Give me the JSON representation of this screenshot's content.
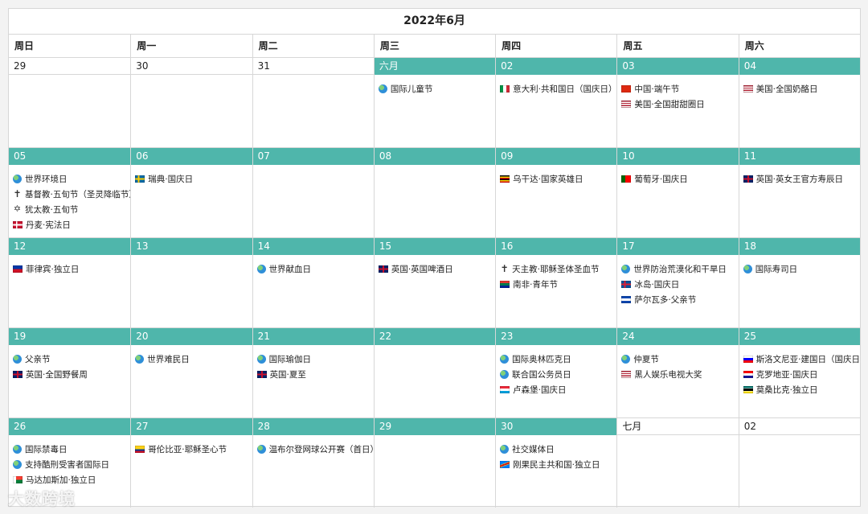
{
  "calendar": {
    "title": "2022年6月",
    "weekdays": [
      "周日",
      "周一",
      "周二",
      "周三",
      "周四",
      "周五",
      "周六"
    ],
    "weeks": [
      [
        {
          "label": "29",
          "current": false,
          "events": []
        },
        {
          "label": "30",
          "current": false,
          "events": []
        },
        {
          "label": "31",
          "current": false,
          "events": []
        },
        {
          "label": "六月",
          "current": true,
          "events": [
            {
              "icon": "globe",
              "text": "国际儿童节"
            }
          ]
        },
        {
          "label": "02",
          "current": true,
          "events": [
            {
              "icon": "flag-italy",
              "text": "意大利·共和国日（国庆日）"
            }
          ]
        },
        {
          "label": "03",
          "current": true,
          "events": [
            {
              "icon": "flag-china",
              "text": "中国·端午节"
            },
            {
              "icon": "flag-usa",
              "text": "美国·全国甜甜圈日"
            }
          ]
        },
        {
          "label": "04",
          "current": true,
          "events": [
            {
              "icon": "flag-usa",
              "text": "美国·全国奶酪日"
            }
          ]
        }
      ],
      [
        {
          "label": "05",
          "current": true,
          "events": [
            {
              "icon": "globe",
              "text": "世界环境日"
            },
            {
              "icon": "cross",
              "text": "基督教·五旬节（圣灵降临节）"
            },
            {
              "icon": "star-of-david",
              "text": "犹太教·五旬节"
            },
            {
              "icon": "flag-denmark",
              "text": "丹麦·宪法日"
            }
          ]
        },
        {
          "label": "06",
          "current": true,
          "events": [
            {
              "icon": "flag-sweden",
              "text": "瑞典·国庆日"
            }
          ]
        },
        {
          "label": "07",
          "current": true,
          "events": []
        },
        {
          "label": "08",
          "current": true,
          "events": []
        },
        {
          "label": "09",
          "current": true,
          "events": [
            {
              "icon": "flag-uganda",
              "text": "乌干达·国家英雄日"
            }
          ]
        },
        {
          "label": "10",
          "current": true,
          "events": [
            {
              "icon": "flag-portugal",
              "text": "葡萄牙·国庆日"
            }
          ]
        },
        {
          "label": "11",
          "current": true,
          "events": [
            {
              "icon": "flag-uk",
              "text": "英国·英女王官方寿辰日"
            }
          ]
        }
      ],
      [
        {
          "label": "12",
          "current": true,
          "events": [
            {
              "icon": "flag-philippines",
              "text": "菲律宾·独立日"
            }
          ]
        },
        {
          "label": "13",
          "current": true,
          "events": []
        },
        {
          "label": "14",
          "current": true,
          "events": [
            {
              "icon": "globe",
              "text": "世界献血日"
            }
          ]
        },
        {
          "label": "15",
          "current": true,
          "events": [
            {
              "icon": "flag-uk",
              "text": "英国·英国啤酒日"
            }
          ]
        },
        {
          "label": "16",
          "current": true,
          "events": [
            {
              "icon": "cross",
              "text": "天主教·耶稣圣体圣血节"
            },
            {
              "icon": "flag-south-africa",
              "text": "南非·青年节"
            }
          ]
        },
        {
          "label": "17",
          "current": true,
          "events": [
            {
              "icon": "globe",
              "text": "世界防治荒漠化和干旱日"
            },
            {
              "icon": "flag-iceland",
              "text": "冰岛·国庆日"
            },
            {
              "icon": "flag-el-salvador",
              "text": "萨尔瓦多·父亲节"
            }
          ]
        },
        {
          "label": "18",
          "current": true,
          "events": [
            {
              "icon": "globe",
              "text": "国际寿司日"
            }
          ]
        }
      ],
      [
        {
          "label": "19",
          "current": true,
          "events": [
            {
              "icon": "globe",
              "text": "父亲节"
            },
            {
              "icon": "flag-uk",
              "text": "英国·全国野餐周"
            }
          ]
        },
        {
          "label": "20",
          "current": true,
          "events": [
            {
              "icon": "globe",
              "text": "世界难民日"
            }
          ]
        },
        {
          "label": "21",
          "current": true,
          "events": [
            {
              "icon": "globe",
              "text": "国际瑜伽日"
            },
            {
              "icon": "flag-uk",
              "text": "英国·夏至"
            }
          ]
        },
        {
          "label": "22",
          "current": true,
          "events": []
        },
        {
          "label": "23",
          "current": true,
          "events": [
            {
              "icon": "globe",
              "text": "国际奥林匹克日"
            },
            {
              "icon": "globe",
              "text": "联合国公务员日"
            },
            {
              "icon": "flag-luxembourg",
              "text": "卢森堡·国庆日"
            }
          ]
        },
        {
          "label": "24",
          "current": true,
          "events": [
            {
              "icon": "globe",
              "text": "仲夏节"
            },
            {
              "icon": "flag-usa",
              "text": "黑人娱乐电视大奖"
            }
          ]
        },
        {
          "label": "25",
          "current": true,
          "events": [
            {
              "icon": "flag-slovenia",
              "text": "斯洛文尼亚·建国日（国庆日）"
            },
            {
              "icon": "flag-croatia",
              "text": "克罗地亚·国庆日"
            },
            {
              "icon": "flag-mozambique",
              "text": "莫桑比克·独立日"
            }
          ]
        }
      ],
      [
        {
          "label": "26",
          "current": true,
          "events": [
            {
              "icon": "globe",
              "text": "国际禁毒日"
            },
            {
              "icon": "globe",
              "text": "支持酷刑受害者国际日"
            },
            {
              "icon": "flag-madagascar",
              "text": "马达加斯加·独立日"
            }
          ]
        },
        {
          "label": "27",
          "current": true,
          "events": [
            {
              "icon": "flag-colombia",
              "text": "哥伦比亚·耶稣圣心节"
            }
          ]
        },
        {
          "label": "28",
          "current": true,
          "events": [
            {
              "icon": "globe",
              "text": "温布尔登网球公开赛（首日）"
            }
          ]
        },
        {
          "label": "29",
          "current": true,
          "events": []
        },
        {
          "label": "30",
          "current": true,
          "events": [
            {
              "icon": "globe",
              "text": "社交媒体日"
            },
            {
              "icon": "flag-dr-congo",
              "text": "刚果民主共和国·独立日"
            }
          ]
        },
        {
          "label": "七月",
          "current": false,
          "events": []
        },
        {
          "label": "02",
          "current": false,
          "events": []
        }
      ]
    ]
  },
  "watermark": "大数跨境",
  "colors": {
    "accent": "#4fb6ab",
    "border": "#d7d7d7",
    "background": "#f3f3f3"
  }
}
